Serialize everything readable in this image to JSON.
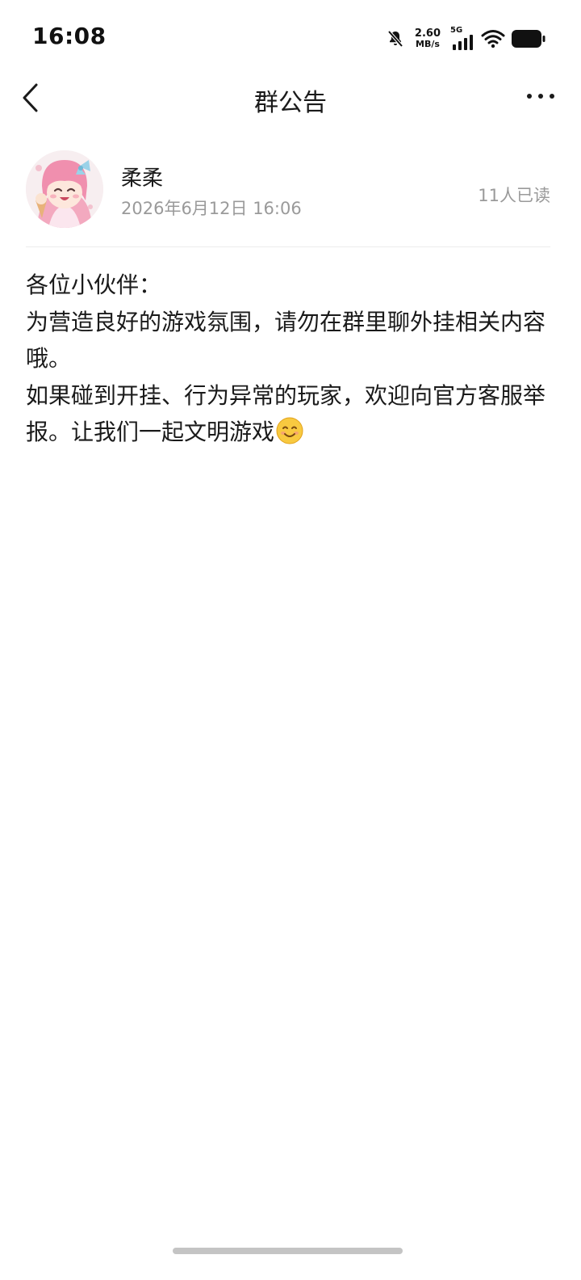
{
  "status_bar": {
    "time": "16:08",
    "net_speed_value": "2.60",
    "net_speed_unit": "MB/s",
    "network_type": "5G",
    "icons": [
      "bell-muted-icon",
      "signal-icon",
      "wifi-icon",
      "battery-icon"
    ]
  },
  "header": {
    "title": "群公告",
    "back_icon": "chevron-left-icon",
    "more_icon": "more-dots-icon"
  },
  "announcement": {
    "author_name": "柔柔",
    "posted_time": "2026年6月12日 16:06",
    "read_count": "11人已读",
    "lines": [
      "各位小伙伴：",
      "为营造良好的游戏氛围，请勿在群里聊外挂相关内容哦。",
      "如果碰到开挂、行为异常的玩家，欢迎向官方客服举报。让我们一起文明游戏"
    ],
    "trailing_emoji_icon": "smiling-face-icon"
  },
  "colors": {
    "text_primary": "#1a1a1a",
    "text_secondary": "#9a9a9a",
    "divider": "#ececec",
    "home_indicator": "#c4c4c4"
  }
}
